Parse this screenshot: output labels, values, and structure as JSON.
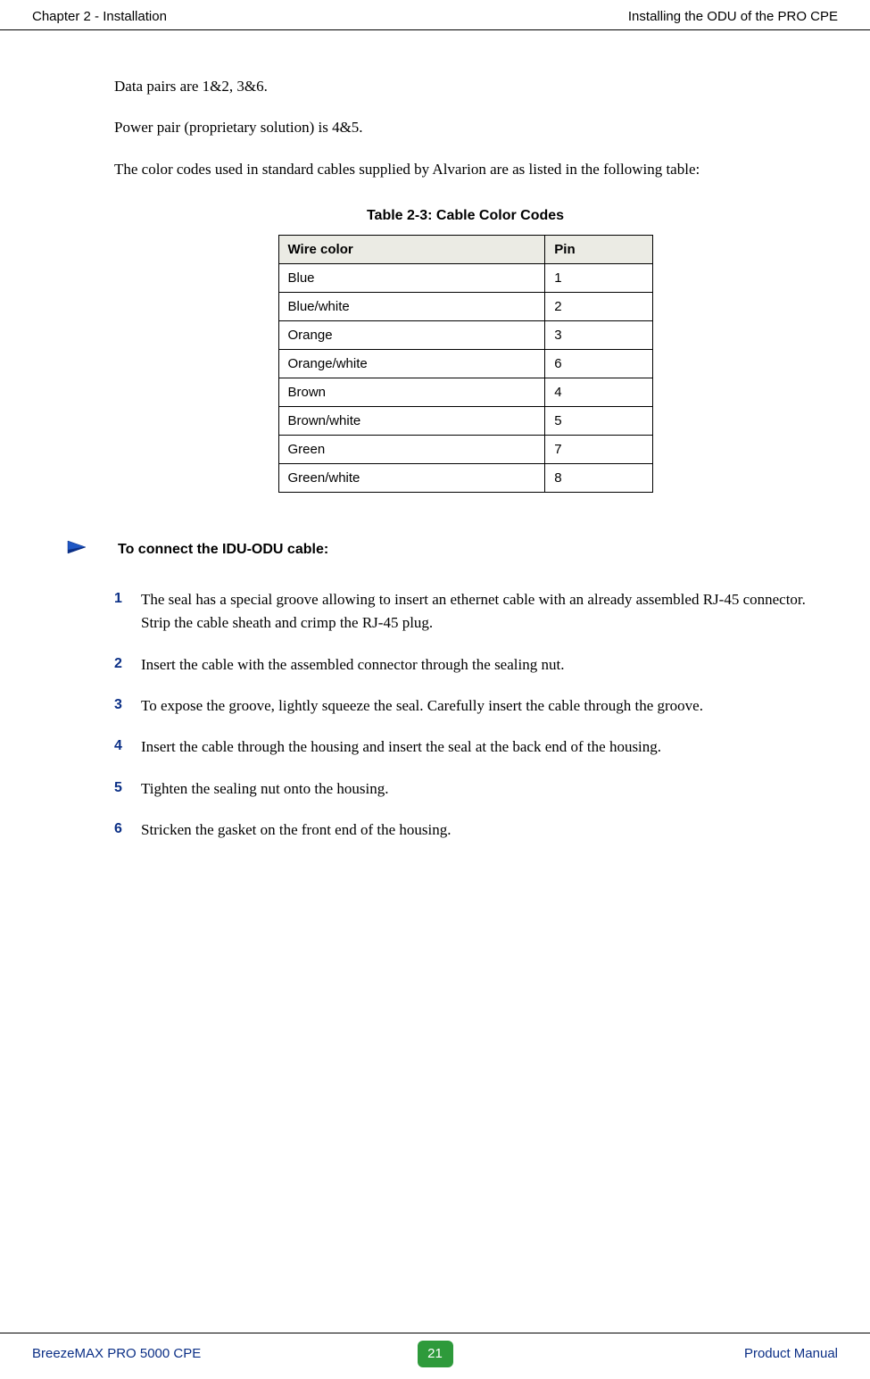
{
  "header": {
    "left": "Chapter 2 - Installation",
    "right": "Installing the ODU of the PRO CPE"
  },
  "paragraphs": {
    "p1": "Data pairs are 1&2, 3&6.",
    "p2": "Power pair (proprietary solution) is 4&5.",
    "p3": "The color codes used in standard cables supplied by Alvarion are as listed in the following table:"
  },
  "table": {
    "caption": "Table 2-3: Cable Color Codes",
    "headers": {
      "col1": "Wire color",
      "col2": "Pin"
    },
    "rows": [
      {
        "color": "Blue",
        "pin": "1"
      },
      {
        "color": "Blue/white",
        "pin": "2"
      },
      {
        "color": "Orange",
        "pin": "3"
      },
      {
        "color": "Orange/white",
        "pin": "6"
      },
      {
        "color": "Brown",
        "pin": "4"
      },
      {
        "color": "Brown/white",
        "pin": "5"
      },
      {
        "color": "Green",
        "pin": "7"
      },
      {
        "color": "Green/white",
        "pin": "8"
      }
    ]
  },
  "procedure": {
    "title": "To connect the IDU-ODU cable:",
    "steps": [
      "The seal has a special groove allowing to insert an ethernet cable with an already assembled RJ-45 connector. Strip the cable sheath and crimp the RJ-45 plug.",
      "Insert the cable with the assembled connector through the sealing nut.",
      "To expose the groove, lightly squeeze the seal. Carefully insert the cable through the groove.",
      "Insert the cable through the housing and insert the seal at the back end of the housing.",
      "Tighten the sealing nut onto the housing.",
      "Stricken the gasket on the front end of the housing."
    ]
  },
  "footer": {
    "left": "BreezeMAX PRO 5000 CPE",
    "page": "21",
    "right": "Product Manual"
  }
}
